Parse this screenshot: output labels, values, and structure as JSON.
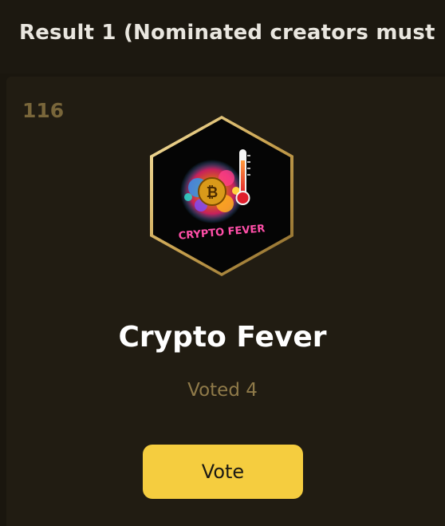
{
  "header": {
    "title": "Result 1 (Nominated creators must"
  },
  "card": {
    "rank": "116",
    "avatar": {
      "icon": "crypto-fever-logo",
      "logo_text": "CRYPTO FEVER"
    },
    "name": "Crypto Fever",
    "votes_text": "Voted 4",
    "vote_button_label": "Vote"
  },
  "colors": {
    "background": "#1a160e",
    "card": "#211c12",
    "accent": "#f5cd3f",
    "muted_gold": "#8f7a49",
    "title_text": "#e9e6df"
  }
}
